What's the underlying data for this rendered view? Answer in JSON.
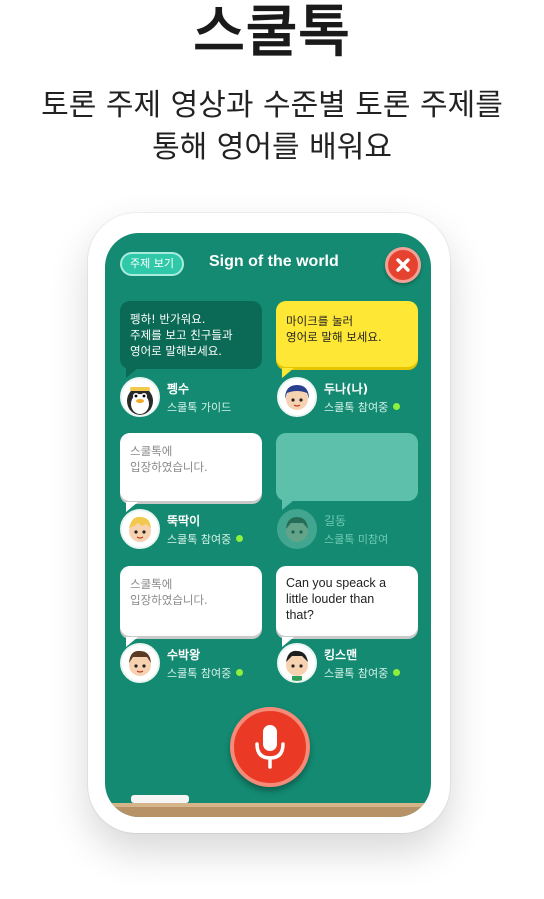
{
  "hero": {
    "title": "스쿨톡",
    "subtitle_line1": "토론 주제 영상과 수준별 토론 주제를",
    "subtitle_line2": "통해 영어를 배워요"
  },
  "screen": {
    "topic_button": "주제 보기",
    "title": "Sign of the world",
    "close_icon": "close-x-icon"
  },
  "bubbles": [
    {
      "style": "guide",
      "lines": [
        "펭하! 반가워요.",
        "주제를 보고 친구들과",
        "영어로 말해보세요."
      ]
    },
    {
      "style": "yellow",
      "lines": [
        "마이크를 눌러",
        "영어로 말해 보세요."
      ]
    },
    {
      "style": "white",
      "lines": [
        "스쿨톡에",
        "입장하였습니다."
      ]
    },
    {
      "style": "empty",
      "lines": []
    },
    {
      "style": "white",
      "lines": [
        "스쿨톡에",
        "입장하였습니다."
      ]
    },
    {
      "style": "white-dark",
      "lines": [
        "Can you speack a",
        "little louder than",
        "that?"
      ]
    }
  ],
  "users": [
    {
      "name": "펭수",
      "status": "스쿨톡 가이드",
      "online": false
    },
    {
      "name": "두나(나)",
      "status": "스쿨톡 참여중",
      "online": true
    },
    {
      "name": "뚝딱이",
      "status": "스쿨톡 참여중",
      "online": true
    },
    {
      "name": "길동",
      "status": "스쿨톡 미참여",
      "online": false
    },
    {
      "name": "수박왕",
      "status": "스쿨톡 참여중",
      "online": true
    },
    {
      "name": "킹스맨",
      "status": "스쿨톡 참여중",
      "online": true
    }
  ],
  "mic_icon": "microphone-icon",
  "colors": {
    "board_green": "#138a71",
    "accent_red": "#e64230",
    "bubble_yellow": "#ffe735",
    "online_green": "#8ef03c"
  }
}
